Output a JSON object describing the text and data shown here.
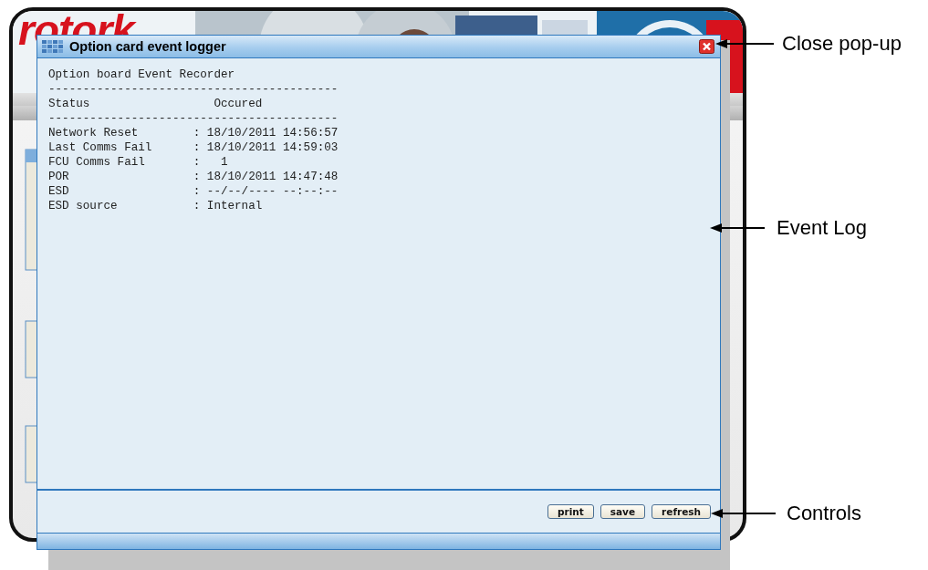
{
  "window": {
    "title": "Option card event logger"
  },
  "background": {
    "logo": "rotork"
  },
  "log": [
    {
      "kind": "title",
      "text": "Option board Event Recorder"
    },
    {
      "kind": "rule",
      "text": "------------------------------------------"
    },
    {
      "kind": "header",
      "columns": [
        "Status",
        "Occured"
      ]
    },
    {
      "kind": "rule",
      "text": "------------------------------------------"
    },
    {
      "kind": "row",
      "status": "Network Reset",
      "occurred": ": 18/10/2011 14:56:57"
    },
    {
      "kind": "row",
      "status": "Last Comms Fail",
      "occurred": ": 18/10/2011 14:59:03"
    },
    {
      "kind": "row",
      "status": "FCU Comms Fail",
      "occurred": ":   1"
    },
    {
      "kind": "row",
      "status": "POR",
      "occurred": ": 18/10/2011 14:47:48"
    },
    {
      "kind": "row",
      "status": "ESD",
      "occurred": ": --/--/---- --:--:--"
    },
    {
      "kind": "row",
      "status": "ESD source",
      "occurred": ": Internal"
    }
  ],
  "buttons": [
    {
      "label": "print"
    },
    {
      "label": "save"
    },
    {
      "label": "refresh"
    }
  ],
  "annotations": [
    {
      "kind": "close",
      "label": "Close pop-up"
    },
    {
      "kind": "log",
      "label": "Event Log"
    },
    {
      "kind": "controls",
      "label": "Controls"
    }
  ]
}
